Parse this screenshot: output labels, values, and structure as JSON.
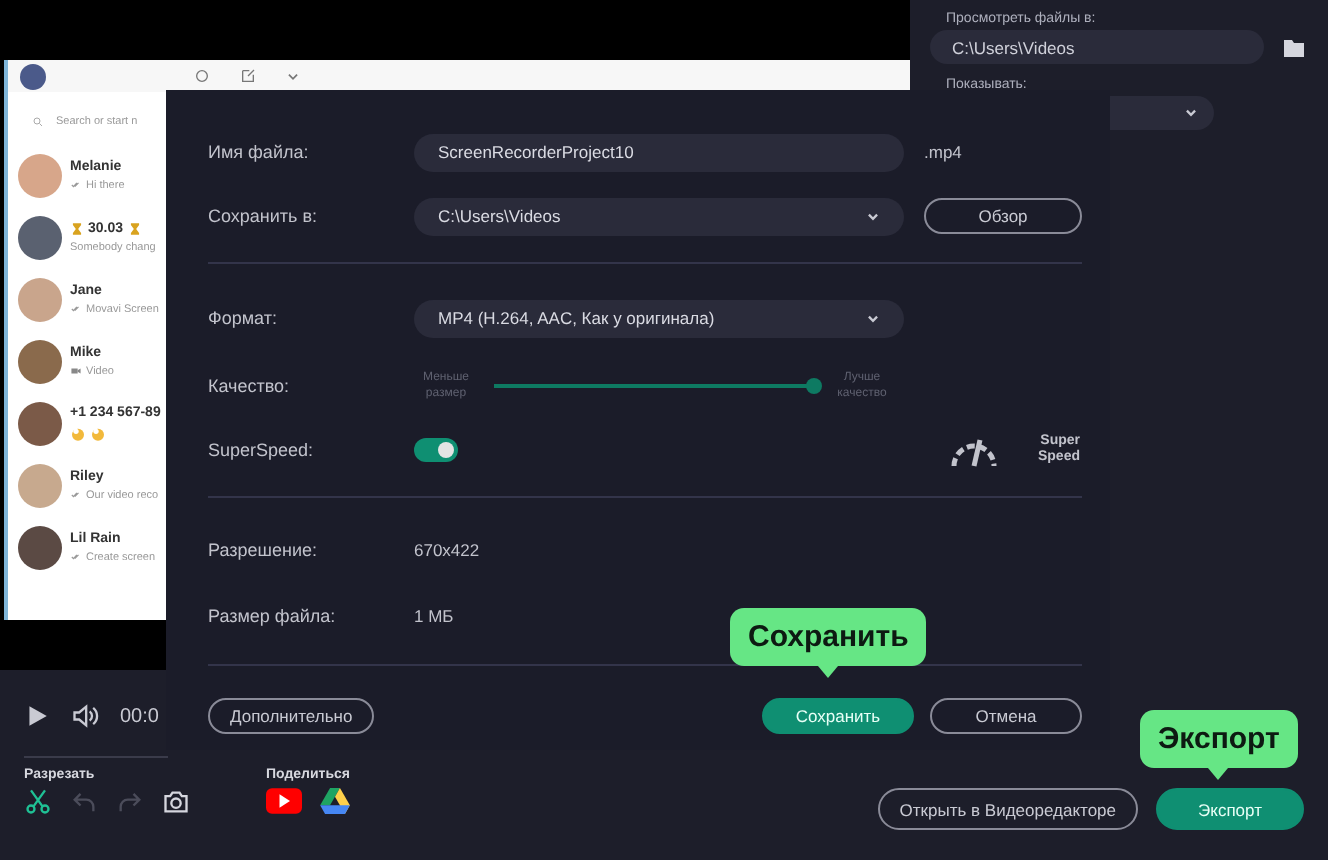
{
  "chat_preview": {
    "search": {
      "placeholder": "Search or start n"
    },
    "chats": [
      {
        "kind": "read",
        "name": "Melanie",
        "message": "Hi there"
      },
      {
        "kind": "timer",
        "name": "30.03",
        "message": "Somebody chang"
      },
      {
        "kind": "read",
        "name": "Jane",
        "message": "Movavi Screen"
      },
      {
        "kind": "video",
        "name": "Mike",
        "message": "Video"
      },
      {
        "kind": "emoji",
        "name": "+1 234 567-89"
      },
      {
        "kind": "read",
        "name": "Riley",
        "message": "Our video reco"
      },
      {
        "kind": "read",
        "name": "Lil Rain",
        "message": "Create screen"
      }
    ]
  },
  "side_panel": {
    "browse_label": "Просмотреть файлы в:",
    "browse_path": "C:\\Users\\Videos",
    "show_label": "Показывать:"
  },
  "dialog": {
    "file_name": {
      "label": "Имя файла:",
      "value": "ScreenRecorderProject10",
      "extension": ".mp4"
    },
    "save_to": {
      "label": "Сохранить в:",
      "value": "C:\\Users\\Videos",
      "button": "Обзор"
    },
    "format": {
      "label": "Формат:",
      "value": "MP4 (H.264, AAC, Как у оригинала)"
    },
    "quality": {
      "label": "Качество:",
      "min_label": "Меньше размер",
      "max_label": "Лучше качество",
      "level": 1
    },
    "superspeed": {
      "label": "SuperSpeed:",
      "on": true,
      "badge": "Super Speed"
    },
    "resolution": {
      "label": "Разрешение:",
      "value": "670x422"
    },
    "file_size": {
      "label": "Размер файла:",
      "value": "1 МБ"
    },
    "buttons": [
      {
        "kind": "outline",
        "label": "Дополнительно"
      },
      {
        "kind": "primary",
        "label": "Сохранить"
      },
      {
        "kind": "outline",
        "label": "Отмена"
      }
    ]
  },
  "player": {
    "time": "00:0"
  },
  "toolbar": {
    "cut_label": "Разрезать",
    "tools": [
      {
        "kind": "cut",
        "disabled": false
      },
      {
        "kind": "undo",
        "disabled": true
      },
      {
        "kind": "redo",
        "disabled": true
      },
      {
        "kind": "snapshot",
        "disabled": false
      }
    ],
    "share_label": "Поделиться",
    "share": [
      {
        "kind": "youtube"
      },
      {
        "kind": "drive"
      }
    ],
    "buttons": [
      {
        "kind": "outline",
        "label": "Открыть в Видеоредакторе"
      },
      {
        "kind": "primary",
        "label": "Экспорт"
      }
    ]
  },
  "callouts": [
    {
      "text": "Сохранить"
    },
    {
      "text": "Экспорт"
    }
  ]
}
